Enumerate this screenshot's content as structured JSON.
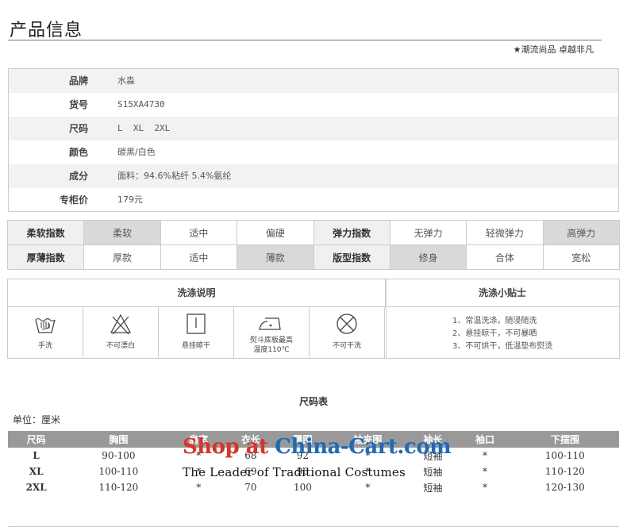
{
  "header": {
    "title": "产品信息",
    "slogan": "★潮流尚品 卓越非凡"
  },
  "info": [
    {
      "label": "品牌",
      "value": "水淼"
    },
    {
      "label": "货号",
      "value": "S15XA4730"
    },
    {
      "label": "尺码",
      "value": "L  XL  2XL"
    },
    {
      "label": "颜色",
      "value": "碳黑/白色"
    },
    {
      "label": "成分",
      "value": "面料：94.6%粘纤 5.4%氨纶"
    },
    {
      "label": "专柜价",
      "value": "179元"
    }
  ],
  "indices": {
    "row1": [
      "柔软指数",
      "柔软",
      "适中",
      "偏硬",
      "弹力指数",
      "无弹力",
      "轻微弹力",
      "高弹力"
    ],
    "row2": [
      "厚薄指数",
      "厚款",
      "适中",
      "薄款",
      "版型指数",
      "修身",
      "合体",
      "宽松"
    ]
  },
  "wash": {
    "title": "洗涤说明",
    "tips_title": "洗涤小贴士",
    "icons": [
      {
        "icon": "hand-wash-icon",
        "label": "手洗"
      },
      {
        "icon": "no-bleach-icon",
        "label": "不可漂白"
      },
      {
        "icon": "hang-dry-icon",
        "label": "悬挂晾干"
      },
      {
        "icon": "iron-icon",
        "label": "熨斗底板最高",
        "label2": "温度110℃"
      },
      {
        "icon": "no-dry-clean-icon",
        "label": "不可干洗"
      }
    ],
    "tips": [
      "1、常温洗涤，随浸随洗",
      "2、悬挂晾干，不可暴晒",
      "3、不可烘干，低温垫布熨烫"
    ]
  },
  "size_chart": {
    "title": "尺码表",
    "unit": "单位：厘米",
    "headers": [
      "尺码",
      "胸围",
      "肩宽",
      "衣长",
      "腰围",
      "袖夹围",
      "袖长",
      "袖口",
      "下摆围"
    ],
    "rows": [
      [
        "L",
        "90-100",
        "*",
        "68",
        "92",
        "*",
        "短袖",
        "*",
        "100-110"
      ],
      [
        "XL",
        "100-110",
        "*",
        "69",
        "96",
        "*",
        "短袖",
        "*",
        "110-120"
      ],
      [
        "2XL",
        "110-120",
        "*",
        "70",
        "100",
        "*",
        "短袖",
        "*",
        "120-130"
      ]
    ]
  },
  "watermark": {
    "line1a": "Shop at ",
    "line1b": "China-Cart.com",
    "line2": "The Leader of  Traditional Costumes"
  }
}
